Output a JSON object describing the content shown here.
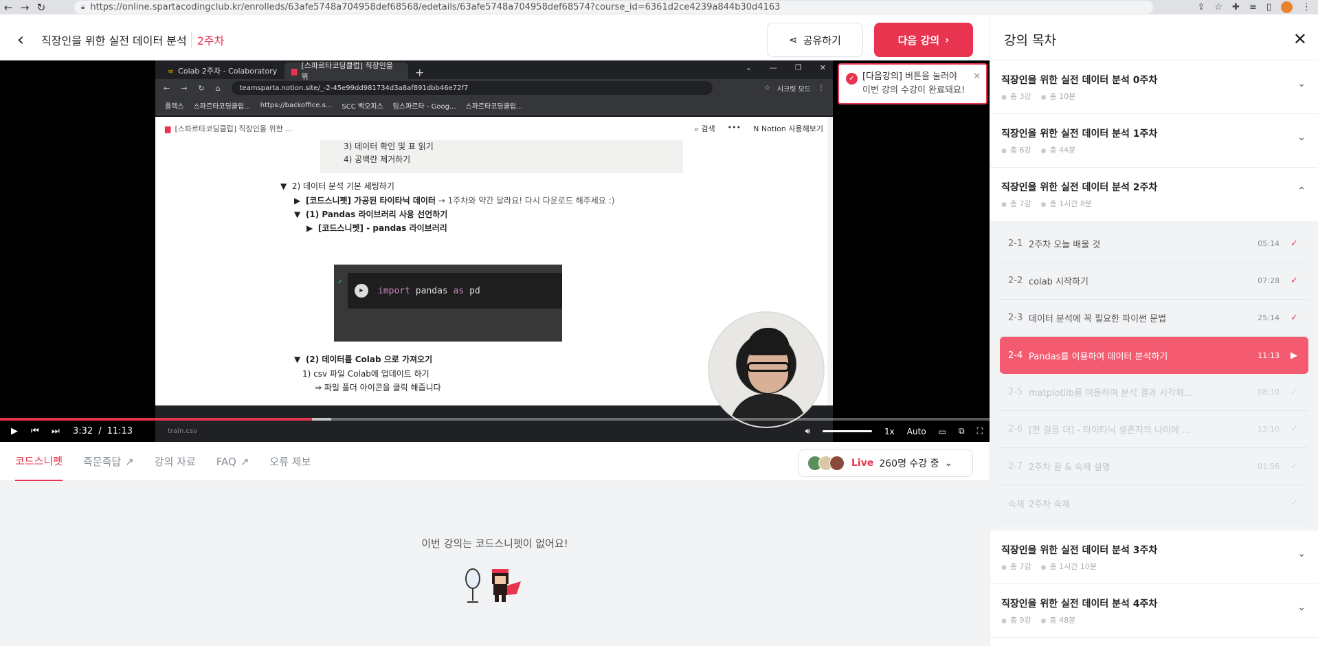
{
  "browser": {
    "url": "https://online.spartacodingclub.kr/enrolleds/63afe5748a704958def68568/edetails/63afe5748a704958def68574?course_id=6361d2ce4239a844b30d4163"
  },
  "header": {
    "course_title": "직장인을 위한 실전 데이터 분석",
    "week": "2주차",
    "share_label": "공유하기",
    "next_label": "다음 강의"
  },
  "toast": {
    "line1_bold": "[다음강의]",
    "line1_rest": " 버튼을 눌러야",
    "line2": "이번 강의 수강이 완료돼요!"
  },
  "video_frame": {
    "tab1": "Colab 2주차 - Colaboratory",
    "tab2": "[스파르타코딩클럽] 직장인을 위",
    "url": "teamsparta.notion.site/_-2-45e99dd981734d3a8af891dbb46e72f7",
    "secret_mode": "시크릿 모드",
    "bookmarks": [
      "플렉스",
      "스파르타코딩클럽...",
      "https://backoffice.s...",
      "SCC 백오피스",
      "팀스파르타 - Goog...",
      "스파르타코딩클럽..."
    ],
    "notion_page": "[스파르타코딩클럽] 직장인을 위한 ...",
    "notion_search": "검색",
    "notion_try": "Notion 사용해보기",
    "gray_line1": "3) 데이터 확인 및 표 읽기",
    "gray_line2": "4) 공백란 제거하기",
    "section": "2) 데이터 분석 기본 세팅하기",
    "item1_bold": "[코드스니펫] 가공된 타이타닉 데이터",
    "item1_rest": " → 1주차와 약간 달라요! 다시 다운로드 해주세요 :)",
    "item2": "(1) Pandas 라이브러리 사용 선언하기",
    "item3": "[코드스니펫] - pandas 라이브러리",
    "code_kw1": "import",
    "code_mod": "pandas",
    "code_kw2": "as",
    "code_alias": "pd",
    "item4": "(2) 데이터를 Colab 으로 가져오기",
    "item5": "1) csv 파일 Colab에 업데이트 하기",
    "item6": "⇒ 파일 폴더 아이콘을 클릭 해줍니다",
    "download_file": "train.csv"
  },
  "player": {
    "current_time": "3:32",
    "separator": "/",
    "duration": "11:13",
    "progress_fraction": 0.315,
    "buffer_fraction": 0.335,
    "speed": "1x",
    "quality": "Auto"
  },
  "tabs": [
    {
      "label": "코드스니펫",
      "external": false
    },
    {
      "label": "즉문즉답",
      "external": true
    },
    {
      "label": "강의 자료",
      "external": false
    },
    {
      "label": "FAQ",
      "external": true
    },
    {
      "label": "오류 제보",
      "external": false
    }
  ],
  "live": {
    "label": "Live",
    "count_text": "260명 수강 중"
  },
  "snippet": {
    "empty_message": "이번 강의는 코드스니펫이 없어요!"
  },
  "sidebar": {
    "title": "강의 목차",
    "weeks": [
      {
        "title": "직장인을 위한 실전 데이터 분석 0주차",
        "lessons": "총 3강",
        "time": "총 10분",
        "expanded": false
      },
      {
        "title": "직장인을 위한 실전 데이터 분석 1주차",
        "lessons": "총 6강",
        "time": "총 44분",
        "expanded": false
      },
      {
        "title": "직장인을 위한 실전 데이터 분석 2주차",
        "lessons": "총 7강",
        "time": "총 1시간 8분",
        "expanded": true
      },
      {
        "title": "직장인을 위한 실전 데이터 분석 3주차",
        "lessons": "총 7강",
        "time": "총 1시간 10분",
        "expanded": false
      },
      {
        "title": "직장인을 위한 실전 데이터 분석 4주차",
        "lessons": "총 9강",
        "time": "총 48분",
        "expanded": false
      }
    ],
    "lessons": [
      {
        "num": "2-1",
        "name": "2주차 오늘 배울 것",
        "dur": "05:14",
        "state": "done"
      },
      {
        "num": "2-2",
        "name": "colab 시작하기",
        "dur": "07:28",
        "state": "done"
      },
      {
        "num": "2-3",
        "name": "데이터 분석에 꼭 필요한 파이썬 문법",
        "dur": "25:14",
        "state": "done"
      },
      {
        "num": "2-4",
        "name": "Pandas를 이용하여 데이터 분석하기",
        "dur": "11:13",
        "state": "current"
      },
      {
        "num": "2-5",
        "name": "matplotlib를 이용하여 분석 결과 시각화...",
        "dur": "08:10",
        "state": "locked"
      },
      {
        "num": "2-6",
        "name": "[한 걸음 더] - 타이타닉 생존자의 나이에 ...",
        "dur": "12:10",
        "state": "locked"
      },
      {
        "num": "2-7",
        "name": "2주차 끝 & 숙제 설명",
        "dur": "01:56",
        "state": "locked"
      },
      {
        "num": "숙제",
        "name": "2주차 숙제",
        "dur": "",
        "state": "locked"
      }
    ]
  },
  "colors": {
    "accent": "#e8344e",
    "current_lesson": "#f45b70"
  }
}
